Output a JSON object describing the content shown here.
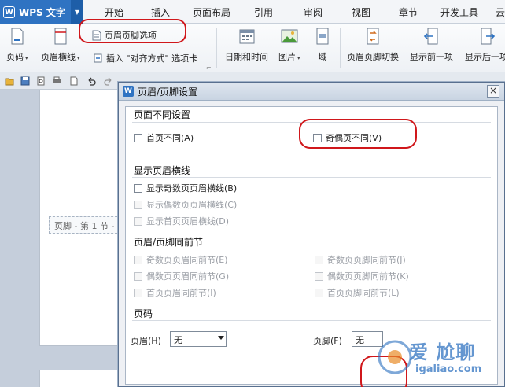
{
  "menubar": {
    "app_logo": "W",
    "app_name": "WPS 文字",
    "app_arrow": "▼",
    "tabs": [
      {
        "label": "开始"
      },
      {
        "label": "插入"
      },
      {
        "label": "页面布局"
      },
      {
        "label": "引用"
      },
      {
        "label": "审阅"
      },
      {
        "label": "视图"
      },
      {
        "label": "章节"
      },
      {
        "label": "开发工具"
      },
      {
        "label": "云"
      }
    ]
  },
  "ribbon": {
    "header_footer_options": "页眉页脚选项",
    "page_number": "页码",
    "header_line": "页眉横线",
    "insert_align_tab": "插入 \"对齐方式\" 选项卡",
    "date_time": "日期和时间",
    "picture": "图片",
    "field": "域",
    "switch_header_footer": "页眉页脚切换",
    "show_previous": "显示前一项",
    "show_next": "显示后一项",
    "dropdown_glyph": "▾",
    "launcher_glyph": "⌐"
  },
  "document": {
    "footer_tag": "页脚 - 第 1 节 -"
  },
  "dialog": {
    "logo": "W",
    "title": "页眉/页脚设置",
    "close": "×",
    "sections": {
      "different_pages": "页面不同设置",
      "header_lines": "显示页眉横线",
      "link_previous": "页眉/页脚同前节",
      "page_number": "页码"
    },
    "options": {
      "first_page_different": "首页不同(A)",
      "odd_even_different": "奇偶页不同(V)",
      "show_odd_header_line": "显示奇数页页眉横线(B)",
      "show_even_header_line": "显示偶数页页眉横线(C)",
      "show_first_header_line": "显示首页页眉横线(D)",
      "odd_header_same": "奇数页页眉同前节(E)",
      "even_header_same": "偶数页页眉同前节(G)",
      "first_header_same": "首页页眉同前节(I)",
      "odd_footer_same": "奇数页页脚同前节(J)",
      "even_footer_same": "偶数页页脚同前节(K)",
      "first_footer_same": "首页页脚同前节(L)"
    },
    "page_number": {
      "header_label": "页眉(H)",
      "header_value": "无",
      "footer_label": "页脚(F)",
      "footer_value": "无"
    }
  },
  "watermark": {
    "text": "爱 尬聊",
    "url": "igaliao.com"
  },
  "colors": {
    "accent_blue": "#2f73c2",
    "highlight_red": "#d0171b"
  }
}
